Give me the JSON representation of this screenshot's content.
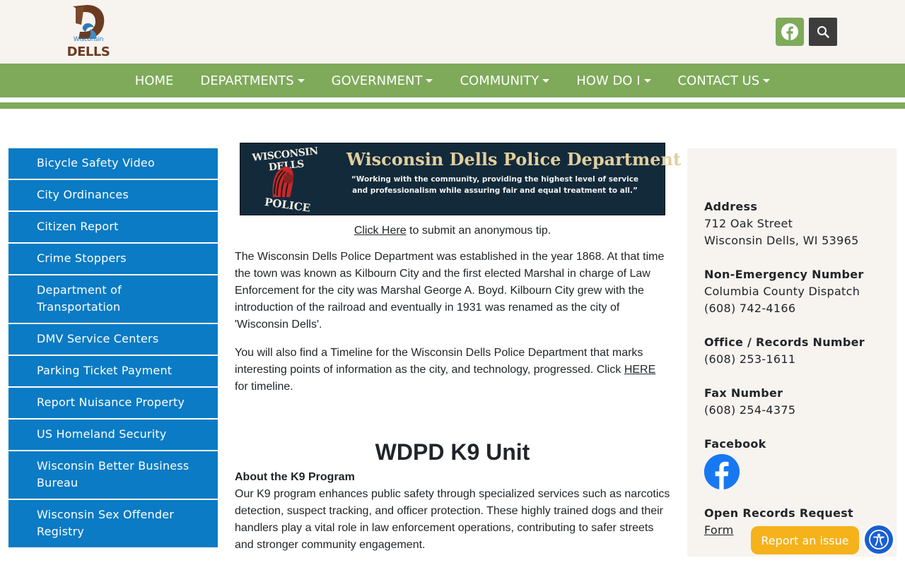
{
  "logo": {
    "small_text": "Wisconsin",
    "big_text": "DELLS"
  },
  "header": {
    "facebook_icon": "facebook-icon",
    "search_icon": "search-icon"
  },
  "nav": {
    "items": [
      {
        "label": "HOME",
        "dropdown": false
      },
      {
        "label": "DEPARTMENTS",
        "dropdown": true
      },
      {
        "label": "GOVERNMENT",
        "dropdown": true
      },
      {
        "label": "COMMUNITY",
        "dropdown": true
      },
      {
        "label": "HOW DO I",
        "dropdown": true
      },
      {
        "label": "CONTACT US",
        "dropdown": true
      }
    ]
  },
  "sidebar": {
    "items": [
      {
        "label": "Bicycle Safety Video"
      },
      {
        "label": "City Ordinances"
      },
      {
        "label": "Citizen Report"
      },
      {
        "label": "Crime Stoppers"
      },
      {
        "label": "Department of Transportation"
      },
      {
        "label": "DMV Service Centers"
      },
      {
        "label": "Parking Ticket Payment"
      },
      {
        "label": "Report Nuisance Property"
      },
      {
        "label": "US Homeland Security"
      },
      {
        "label": "Wisconsin Better Business Bureau"
      },
      {
        "label": "Wisconsin Sex Offender Registry"
      }
    ]
  },
  "banner": {
    "badge_top": "WISCONSIN DELLS",
    "badge_bottom": "POLICE",
    "title": "Wisconsin Dells Police Department",
    "quote": "“Working with the community, providing the highest level of service and professionalism while assuring fair and equal treatment to all.”"
  },
  "main": {
    "tip_link": "Click Here",
    "tip_text": " to submit an anonymous tip.",
    "para1": "The Wisconsin Dells Police Department was established in the year 1868. At that time the town was known as Kilbourn City and the first elected Marshal in charge of Law Enforcement for the city was Marshal George A. Boyd. Kilbourn City grew with the introduction of the railroad and eventually in 1931 was renamed as the city of 'Wisconsin Dells'.",
    "para2_before": "You will also find a Timeline for the Wisconsin Dells Police Department that marks interesting points of information as the city, and technology, progressed. Click ",
    "para2_link": "HERE",
    "para2_after": " for timeline.",
    "k9_title": "WDPD K9 Unit",
    "k9_subtitle": "About the K9 Program",
    "k9_text": "Our K9 program enhances public safety through specialized services such as narcotics detection, suspect tracking, and officer protection. These highly trained dogs and their handlers play a vital role in law enforcement operations, contributing to safer streets and stronger community engagement."
  },
  "contact": {
    "address_label": "Address",
    "address_line1": "712 Oak Street",
    "address_line2": "Wisconsin Dells, WI 53965",
    "nonemerg_label": "Non-Emergency Number",
    "nonemerg_line1": "Columbia County Dispatch",
    "nonemerg_line2": "(608) 742-4166",
    "office_label": "Office / Records Number",
    "office_line1": "(608) 253-1611",
    "fax_label": "Fax Number",
    "fax_line1": "(608) 254-4375",
    "facebook_label": "Facebook",
    "records_label": "Open Records Request",
    "records_link": "Form"
  },
  "floating": {
    "report_label": "Report an issue",
    "accessibility_icon": "accessibility-icon"
  },
  "colors": {
    "nav_green": "#7eaa5a",
    "sidebar_blue": "#0a7bc4",
    "header_bg": "#f7f3ef",
    "report_orange": "#f5b21b",
    "a11y_blue": "#1a5fd1"
  }
}
